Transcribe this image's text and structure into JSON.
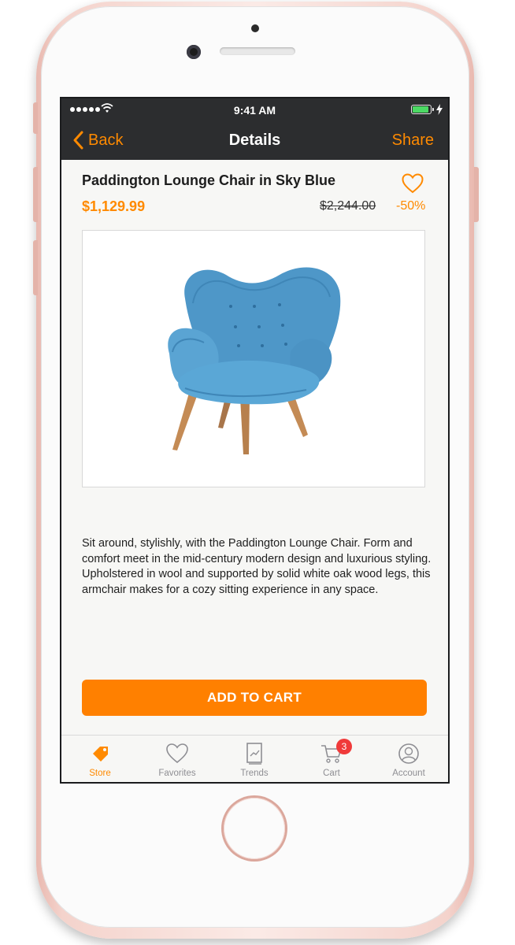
{
  "status_bar": {
    "time": "9:41 AM"
  },
  "nav": {
    "back_label": "Back",
    "title": "Details",
    "share_label": "Share"
  },
  "product": {
    "title": "Paddington Lounge Chair in Sky Blue",
    "price": "$1,129.99",
    "old_price": "$2,244.00",
    "discount": "-50%",
    "description": "Sit around, stylishly, with the Paddington Lounge Chair. Form and comfort meet in the mid-century modern design and luxurious styling. Upholstered in wool and supported by solid white oak wood legs, this armchair makes for a cozy sitting experience in any space.",
    "image_icon": "sky-blue-lounge-chair"
  },
  "actions": {
    "add_to_cart_label": "ADD TO CART"
  },
  "tabbar": {
    "items": [
      {
        "label": "Store",
        "icon": "tag-icon",
        "active": true
      },
      {
        "label": "Favorites",
        "icon": "heart-icon",
        "active": false
      },
      {
        "label": "Trends",
        "icon": "trends-icon",
        "active": false
      },
      {
        "label": "Cart",
        "icon": "cart-icon",
        "active": false,
        "badge": "3"
      },
      {
        "label": "Account",
        "icon": "account-icon",
        "active": false
      }
    ]
  },
  "colors": {
    "accent": "#ff8a00",
    "button": "#ff8000",
    "navbar": "#2c2d2f",
    "badge": "#f03a3a",
    "battery": "#4cd964"
  }
}
